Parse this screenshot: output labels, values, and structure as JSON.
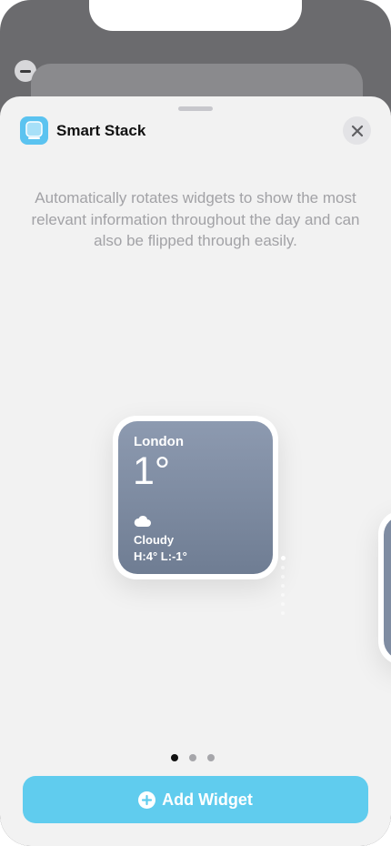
{
  "header": {
    "title": "Smart Stack",
    "app_icon": "smart-stack-icon",
    "close_icon": "close-icon"
  },
  "description": "Automatically rotates widgets to show the most relevant information throughout the day and can also be flipped through easily.",
  "widget": {
    "city": "London",
    "temperature": "1°",
    "condition": "Cloudy",
    "high_low": "H:4° L:-1°",
    "condition_icon": "cloud-icon"
  },
  "pager": {
    "pages": 3,
    "current": 1
  },
  "add_button": {
    "label": "Add Widget",
    "icon": "plus-circle-icon"
  },
  "colors": {
    "accent": "#60ccee",
    "sheet": "#f2f2f2",
    "widget_top": "#8d9ab0",
    "widget_bottom": "#6f7d93"
  }
}
